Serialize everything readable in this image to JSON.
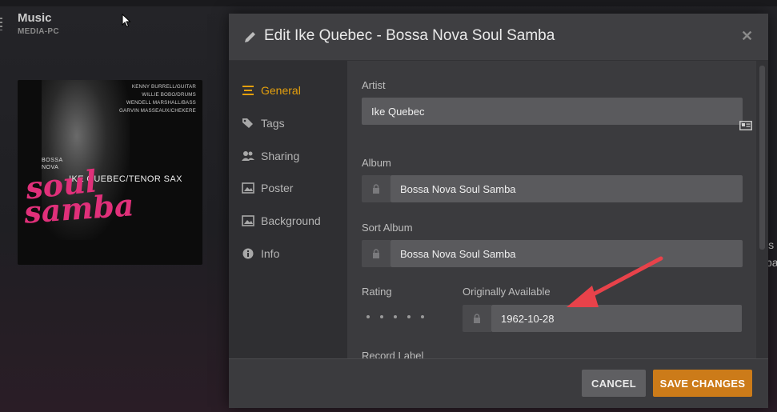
{
  "library": {
    "title": "Music",
    "server": "MEDIA-PC"
  },
  "album_art": {
    "credits": [
      "KENNY BURRELL/GUITAR",
      "WILLIE BOBO/DRUMS",
      "WENDELL MARSHALL/BASS",
      "GARVIN MASSEAUX/CHEKERE"
    ],
    "bossa_nova": "BOSSA\nNOVA",
    "artist_line": "IKE QUEBEC/TENOR SAX",
    "soul": "soul",
    "samba": "samba",
    "accent_color": "#e0307a"
  },
  "modal": {
    "title": "Edit Ike Quebec - Bossa Nova Soul Samba",
    "nav": [
      {
        "label": "General",
        "icon": "list-icon",
        "active": true
      },
      {
        "label": "Tags",
        "icon": "tags-icon",
        "active": false
      },
      {
        "label": "Sharing",
        "icon": "users-icon",
        "active": false
      },
      {
        "label": "Poster",
        "icon": "image-icon",
        "active": false
      },
      {
        "label": "Background",
        "icon": "image-icon",
        "active": false
      },
      {
        "label": "Info",
        "icon": "info-icon",
        "active": false
      }
    ],
    "fields": {
      "artist": {
        "label": "Artist",
        "value": "Ike Quebec"
      },
      "album": {
        "label": "Album",
        "value": "Bossa Nova Soul Samba"
      },
      "sort_album": {
        "label": "Sort Album",
        "value": "Bossa Nova Soul Samba"
      },
      "rating": {
        "label": "Rating",
        "value": 0
      },
      "originally_available": {
        "label": "Originally Available",
        "value": "1962-10-28"
      },
      "record_label": {
        "label": "Record Label"
      }
    },
    "buttons": {
      "cancel": "CANCEL",
      "save": "SAVE CHANGES"
    }
  },
  "colors": {
    "accent": "#e5a00d",
    "save_button": "#cc7b19",
    "annotation_arrow": "#e8424a"
  }
}
